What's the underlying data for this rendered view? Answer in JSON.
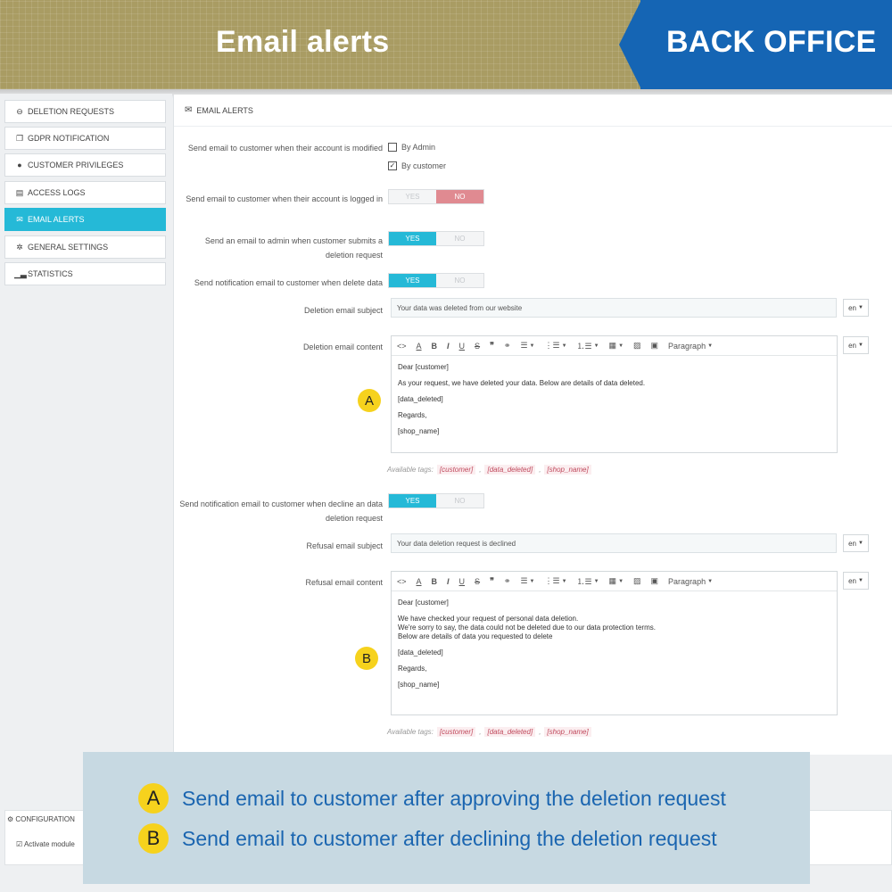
{
  "banner": {
    "title": "Email alerts",
    "tag": "BACK OFFICE"
  },
  "colors": {
    "banner_left": "#a99c63",
    "banner_right": "#1565b4",
    "accent": "#25b9d7",
    "no_active": "#e08a91",
    "marker": "#f6d21d",
    "legend_text": "#1a65b0"
  },
  "sidebar": {
    "items": [
      {
        "label": "DELETION REQUESTS",
        "icon": "minus-circle-icon",
        "active": false
      },
      {
        "label": "GDPR NOTIFICATION",
        "icon": "copy-icon",
        "active": false
      },
      {
        "label": "CUSTOMER PRIVILEGES",
        "icon": "user-icon",
        "active": false
      },
      {
        "label": "ACCESS LOGS",
        "icon": "file-icon",
        "active": false
      },
      {
        "label": "EMAIL ALERTS",
        "icon": "envelope-icon",
        "active": true
      },
      {
        "label": "GENERAL SETTINGS",
        "icon": "gear-icon",
        "active": false
      },
      {
        "label": "STATISTICS",
        "icon": "bar-chart-icon",
        "active": false
      }
    ]
  },
  "panel": {
    "header": "EMAIL ALERTS",
    "modified_label": "Send email to customer when their account is modified",
    "by_admin": "By Admin",
    "by_customer": "By customer",
    "logged_label": "Send email to customer when their account is logged in",
    "admin_label": "Send an email to admin when customer submits a deletion request",
    "notify_delete_label": "Send notification email to customer when delete data",
    "yes": "YES",
    "no": "NO",
    "deletion_subject_label": "Deletion email subject",
    "deletion_subject_value": "Your data was deleted from our website",
    "lang": "en",
    "deletion_content_label": "Deletion email content",
    "editor_paragraph": "Paragraph",
    "deletion_body": {
      "l1": "Dear [customer]",
      "l2": "As your request, we have deleted your data. Below are details of data deleted.",
      "l3": "[data_deleted]",
      "l4": "Regards,",
      "l5": "[shop_name]"
    },
    "tags_label": "Available tags:",
    "tags": [
      "[customer]",
      "[data_deleted]",
      "[shop_name]"
    ],
    "tag_sep": ",",
    "decline_label": "Send notification email to customer when decline an data deletion request",
    "refusal_subject_label": "Refusal email subject",
    "refusal_subject_value": "Your data deletion request is declined",
    "refusal_content_label": "Refusal email content",
    "refusal_body": {
      "l1": "Dear [customer]",
      "l2": "We have checked your request of personal data deletion.",
      "l3": "We're sorry to say, the data could not be deleted due to our data protection terms.",
      "l4": "Below are details of data you requested to delete",
      "l5": "[data_deleted]",
      "l6": "Regards,",
      "l7": "[shop_name]"
    }
  },
  "markers": {
    "a": "A",
    "b": "B"
  },
  "config": {
    "title": "CONFIGURATION",
    "activate": "Activate module"
  },
  "legend": {
    "a_badge": "A",
    "a_text": "Send email to customer after approving the deletion request",
    "b_badge": "B",
    "b_text": "Send email to customer after declining the deletion request"
  }
}
